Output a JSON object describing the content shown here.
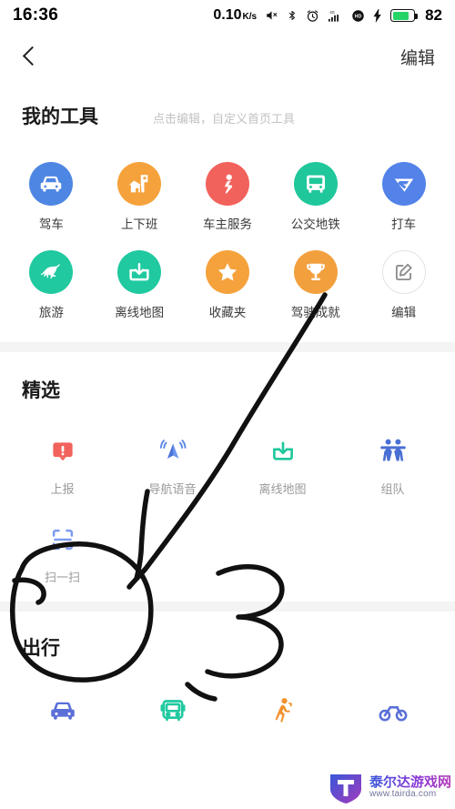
{
  "status_bar": {
    "time": "16:36",
    "network_speed": "0.10",
    "network_unit": "K/s",
    "icons": [
      "mute-icon",
      "bluetooth-icon",
      "alarm-icon",
      "signal-4g-icon",
      "hd-icon",
      "charging-bolt-icon"
    ],
    "battery_percent": "82",
    "battery_color": "#25d366"
  },
  "nav": {
    "back_icon": "chevron-left-icon",
    "edit_label": "编辑"
  },
  "my_tools": {
    "title": "我的工具",
    "subtitle": "点击编辑，自定义首页工具",
    "items": [
      {
        "label": "驾车",
        "icon": "car-icon",
        "bg": "#4e86e3",
        "fg": "#ffffff"
      },
      {
        "label": "上下班",
        "icon": "commute-house-icon",
        "bg": "#f6a githubless"
      },
      {
        "label": "车主服务",
        "icon": "car-owner-icon",
        "bg": "#f2625c",
        "fg": "#ffffff"
      },
      {
        "label": "公交地铁",
        "icon": "bus-icon",
        "bg": "#1fc79b",
        "fg": "#ffffff"
      },
      {
        "label": "打车",
        "icon": "taxi-hail-icon",
        "bg": "#5382e8",
        "fg": "#ffffff"
      },
      {
        "label": "旅游",
        "icon": "horse-icon",
        "bg": "#21c9a0",
        "fg": "#ffffff"
      },
      {
        "label": "离线地图",
        "icon": "download-box-icon",
        "bg": "#21c9a0",
        "fg": "#ffffff"
      },
      {
        "label": "收藏夹",
        "icon": "star-icon",
        "bg": "#f5a23c",
        "fg": "#ffffff"
      },
      {
        "label": "驾驶成就",
        "icon": "trophy-icon",
        "bg": "#f2a03e",
        "fg": "#ffffff"
      },
      {
        "label": "编辑",
        "icon": "edit-pencil-icon",
        "bg": "#ffffff",
        "fg": "#8c8c8c"
      }
    ]
  },
  "featured": {
    "title": "精选",
    "items": [
      {
        "label": "上报",
        "icon": "report-alert-icon",
        "color": "#f2625c"
      },
      {
        "label": "导航语音",
        "icon": "nav-voice-icon",
        "color": "#5b86e5"
      },
      {
        "label": "离线地图",
        "icon": "download-box-icon",
        "color": "#1fc79b"
      },
      {
        "label": "组队",
        "icon": "team-people-icon",
        "color": "#4a6fd4"
      },
      {
        "label": "扫一扫",
        "icon": "scan-frame-icon",
        "color": "#7e9bf0"
      }
    ]
  },
  "travel": {
    "title": "出行",
    "items": [
      {
        "label": "",
        "icon": "car-icon",
        "color": "#5b6fd8"
      },
      {
        "label": "",
        "icon": "bus-icon",
        "color": "#21c9a0"
      },
      {
        "label": "",
        "icon": "walk-icon",
        "color": "#f3922f"
      },
      {
        "label": "",
        "icon": "bicycle-icon",
        "color": "#5b6fd8"
      }
    ]
  },
  "watermark": {
    "brand_cn": "泰尔达游戏网",
    "url": "www.tairda.com"
  }
}
